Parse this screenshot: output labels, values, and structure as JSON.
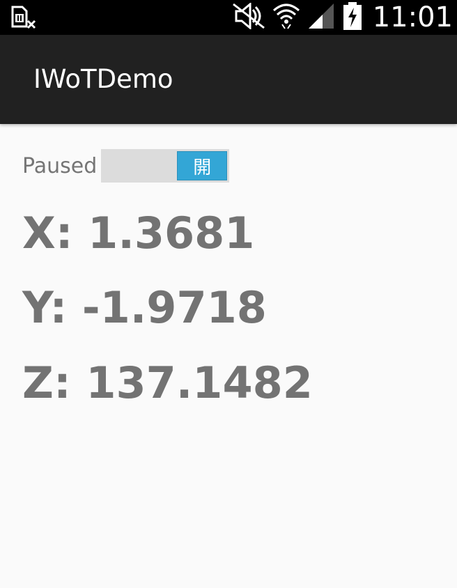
{
  "status_bar": {
    "time": "11:01",
    "icons": [
      "sim-card-error-icon",
      "mute-icon",
      "wifi-icon",
      "signal-icon",
      "battery-charging-icon"
    ]
  },
  "app_bar": {
    "title": "IWoTDemo"
  },
  "toggle": {
    "label": "Paused",
    "thumb_text": "開",
    "state": "on",
    "accent_color": "#33a6d6"
  },
  "readings": {
    "x": "X: 1.3681",
    "y": "Y: -1.9718",
    "z": "Z: 137.1482"
  }
}
